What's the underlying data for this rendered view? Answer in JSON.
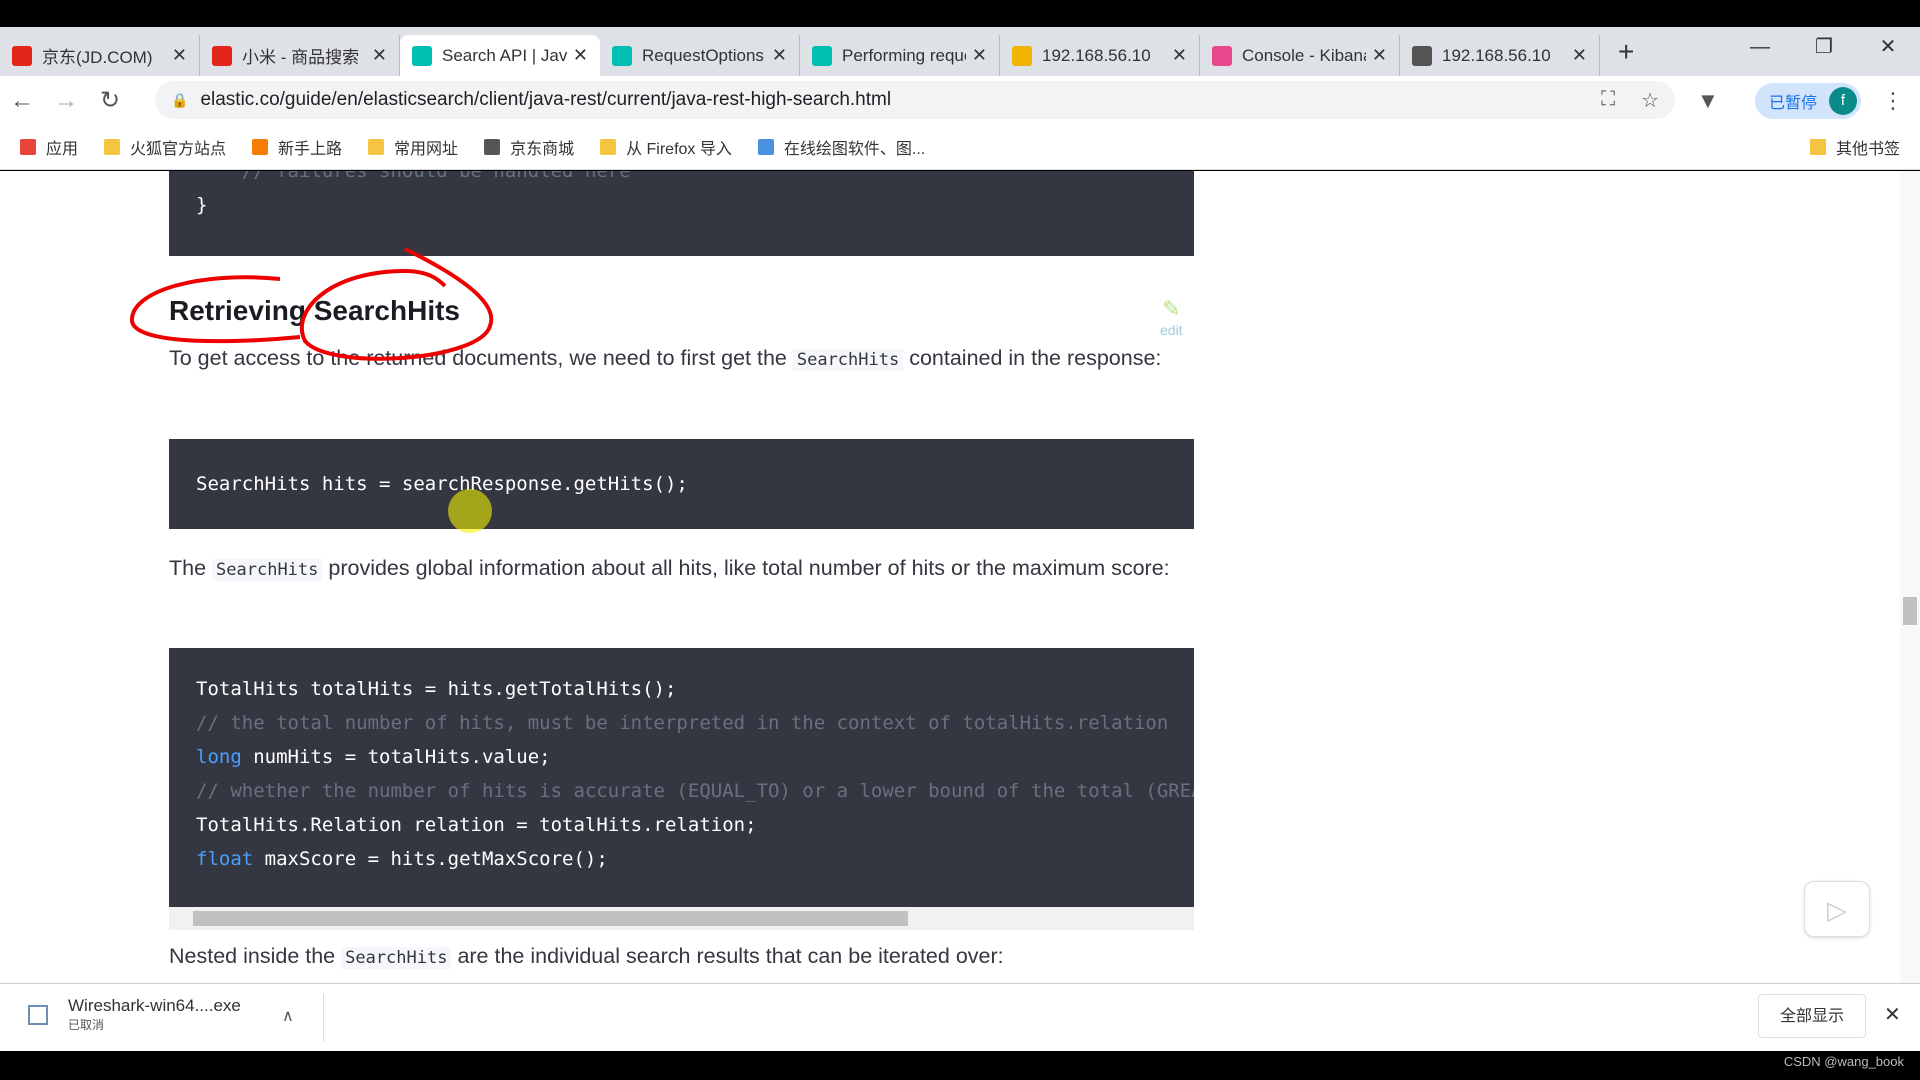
{
  "tabs": [
    {
      "title": "京东(JD.COM)",
      "icon": "jd-icon",
      "color": "#e1251b"
    },
    {
      "title": "小米 - 商品搜索",
      "icon": "jd-icon",
      "color": "#e1251b"
    },
    {
      "title": "Search API | Java",
      "icon": "elastic-icon",
      "color": "#00bfb3",
      "active": true
    },
    {
      "title": "RequestOptions",
      "icon": "elastic-icon",
      "color": "#00bfb3"
    },
    {
      "title": "Performing requests",
      "icon": "elastic-icon",
      "color": "#00bfb3"
    },
    {
      "title": "192.168.56.10",
      "icon": "elasticsearch-icon",
      "color": "#f0b400"
    },
    {
      "title": "Console - Kibana",
      "icon": "kibana-icon",
      "color": "#e8488b"
    },
    {
      "title": "192.168.56.10",
      "icon": "globe-icon",
      "color": "#555"
    }
  ],
  "address": {
    "url": "elastic.co/guide/en/elasticsearch/client/java-rest/current/java-rest-high-search.html",
    "paused_label": "已暂停",
    "avatar": "f"
  },
  "bookmarks": [
    "应用",
    "火狐官方站点",
    "新手上路",
    "常用网址",
    "京东商城",
    "从 Firefox 导入",
    "在线绘图软件、图..."
  ],
  "bookmarks_other": "其他书签",
  "doc": {
    "code0": [
      "    // failures should be handled here",
      "}"
    ],
    "heading": "Retrieving SearchHits",
    "edit": "edit",
    "p1_a": "To get access to the returned documents, we need to first get the ",
    "p1_code": "SearchHits",
    "p1_b": " contained in the response:",
    "code1": "SearchHits hits = searchResponse.getHits();",
    "p2_a": "The ",
    "p2_code": "SearchHits",
    "p2_b": " provides global information about all hits, like total number of hits or the maximum score:",
    "code2": {
      "l1": "TotalHits totalHits = hits.getTotalHits();",
      "l2": "// the total number of hits, must be interpreted in the context of totalHits.relation",
      "l3kw": "long",
      "l3": " numHits = totalHits.value;",
      "l4": "// whether the number of hits is accurate (EQUAL_TO) or a lower bound of the total (GREATER_THAN_OR_EQUAL_TO)",
      "l5": "TotalHits.Relation relation = totalHits.relation;",
      "l6kw": "float",
      "l6": " maxScore = hits.getMaxScore();"
    },
    "p3_a": "Nested inside the ",
    "p3_code": "SearchHits",
    "p3_b": " are the individual search results that can be iterated over:"
  },
  "downloads": {
    "file": "Wireshark-win64....exe",
    "status": "已取消",
    "show_all": "全部显示"
  },
  "watermark": "CSDN @wang_book"
}
